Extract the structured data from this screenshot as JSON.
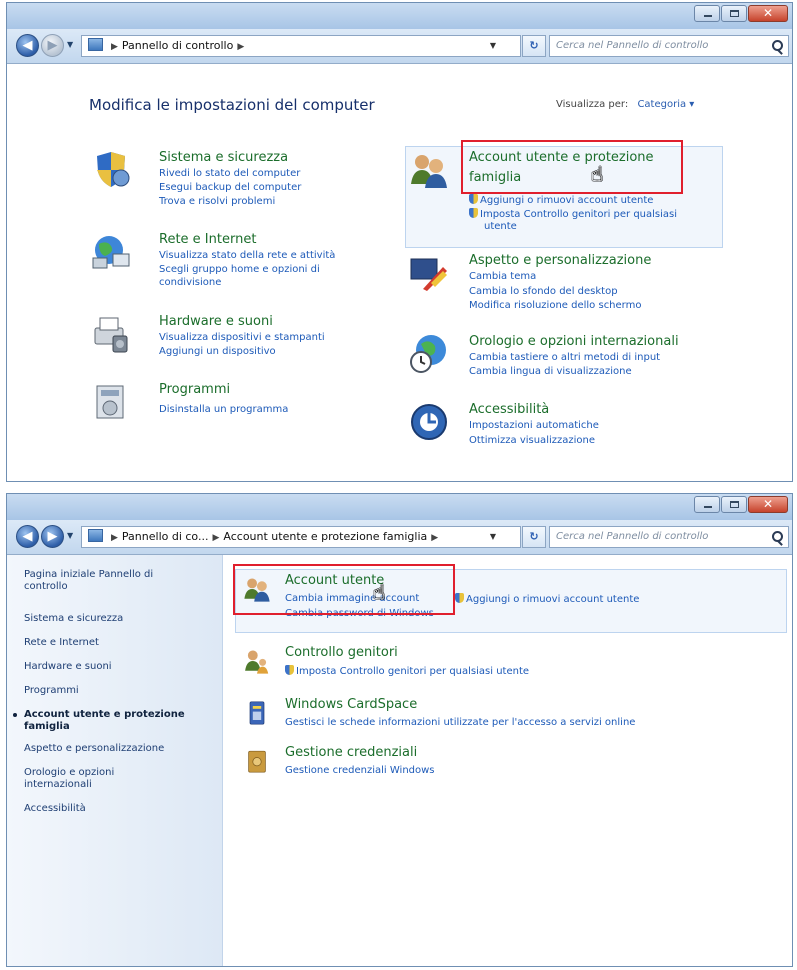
{
  "window1": {
    "address_crumbs": [
      "Pannello di controllo"
    ],
    "search_placeholder": "Cerca nel Pannello di controllo",
    "page_title": "Modifica le impostazioni del computer",
    "view_by_label": "Visualizza per:",
    "view_by_value": "Categoria",
    "categories_left": [
      {
        "title": "Sistema e sicurezza",
        "links": [
          "Rivedi lo stato del computer",
          "Esegui backup del computer",
          "Trova e risolvi problemi"
        ]
      },
      {
        "title": "Rete e Internet",
        "links": [
          "Visualizza stato della rete e attività",
          "Scegli gruppo home e opzioni di",
          "condivisione"
        ]
      },
      {
        "title": "Hardware e suoni",
        "links": [
          "Visualizza dispositivi e stampanti",
          "Aggiungi un dispositivo"
        ]
      },
      {
        "title": "Programmi",
        "links": [
          "Disinstalla un programma"
        ]
      }
    ],
    "categories_right": [
      {
        "title_line1": "Account utente e protezione",
        "title_line2": "famiglia",
        "links": [
          "Aggiungi o rimuovi account utente",
          "Imposta Controllo genitori per qualsiasi",
          "utente"
        ]
      },
      {
        "title": "Aspetto e personalizzazione",
        "links": [
          "Cambia tema",
          "Cambia lo sfondo del desktop",
          "Modifica risoluzione dello schermo"
        ]
      },
      {
        "title": "Orologio e opzioni internazionali",
        "links": [
          "Cambia tastiere o altri metodi di input",
          "Cambia lingua di visualizzazione"
        ]
      },
      {
        "title": "Accessibilità",
        "links": [
          "Impostazioni automatiche",
          "Ottimizza visualizzazione"
        ]
      }
    ]
  },
  "window2": {
    "address_crumbs": [
      "Pannello di co...",
      "Account utente e protezione famiglia"
    ],
    "search_placeholder": "Cerca nel Pannello di controllo",
    "sidebar": {
      "home_line1": "Pagina iniziale Pannello di",
      "home_line2": "controllo",
      "items": [
        "Sistema e sicurezza",
        "Rete e Internet",
        "Hardware e suoni",
        "Programmi"
      ],
      "active_line1": "Account utente e protezione",
      "active_line2": "famiglia",
      "items2": [
        "Aspetto e personalizzazione"
      ],
      "clock_line1": "Orologio e opzioni",
      "clock_line2": "internazionali",
      "access": "Accessibilità"
    },
    "sections": [
      {
        "title": "Account utente",
        "links": [
          "Cambia immagine account",
          "Aggiungi o rimuovi account utente",
          "Cambia password di Windows"
        ]
      },
      {
        "title": "Controllo genitori",
        "links": [
          "Imposta Controllo genitori per qualsiasi utente"
        ]
      },
      {
        "title": "Windows CardSpace",
        "links": [
          "Gestisci le schede informazioni utilizzate per l'accesso a servizi online"
        ]
      },
      {
        "title": "Gestione credenziali",
        "links": [
          "Gestione credenziali Windows"
        ]
      }
    ]
  },
  "caption_close_glyph": "✕",
  "nav_back_glyph": "◀",
  "nav_forward_glyph": "▶",
  "highlight_color": "#e01f2d",
  "title_color": "#1b6d2b",
  "link_color": "#1d5ab8"
}
